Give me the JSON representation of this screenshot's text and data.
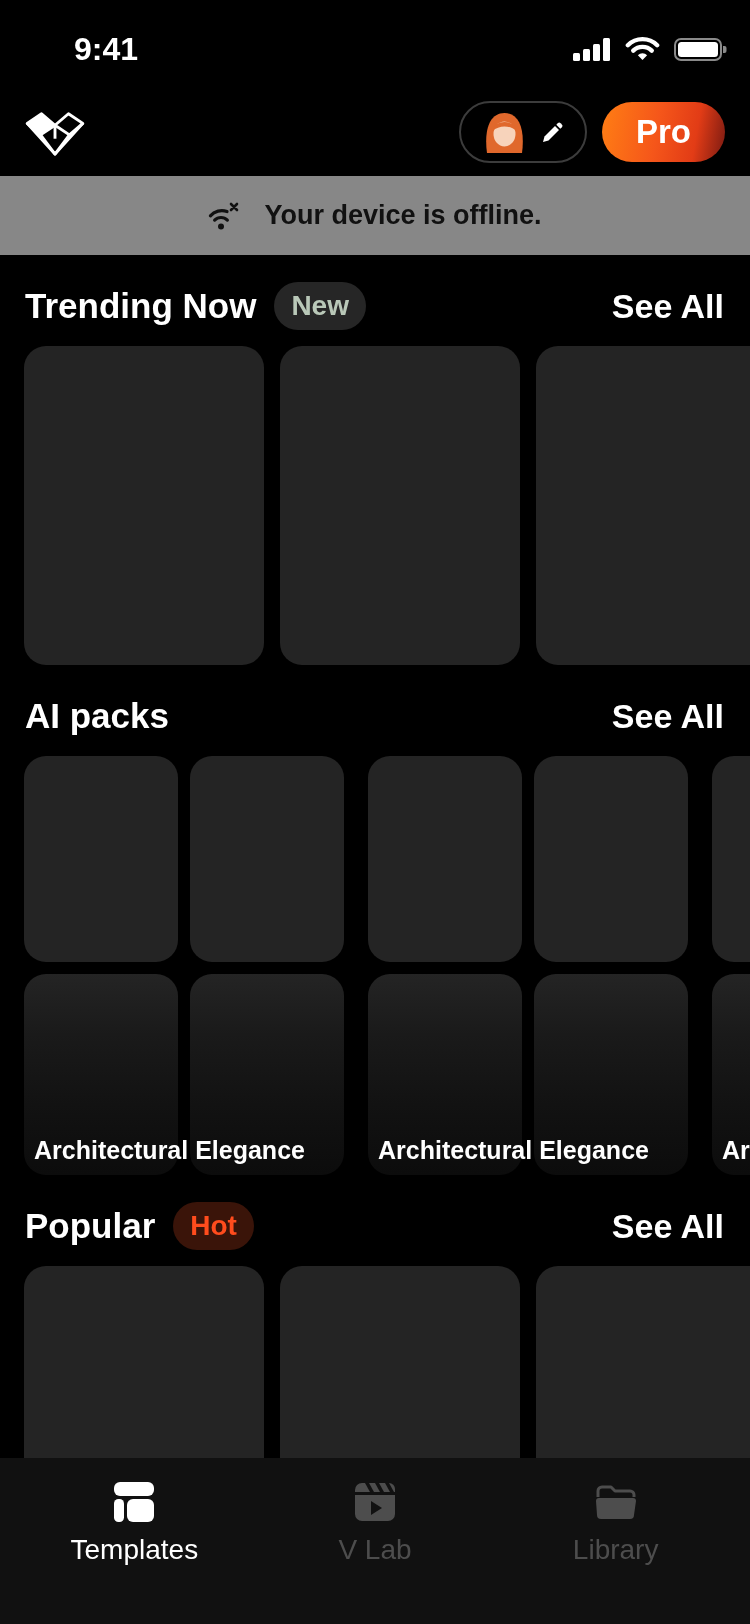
{
  "status_bar": {
    "time": "9:41"
  },
  "header": {
    "pro_button": "Pro"
  },
  "offline_banner": {
    "message": "Your device is offline."
  },
  "sections": [
    {
      "kind": "cards",
      "title": "Trending Now",
      "badge": {
        "label": "New",
        "kind": "new"
      },
      "see_all": "See All",
      "cards": [
        {
          "kind": "thumbnail"
        },
        {
          "kind": "thumbnail"
        },
        {
          "kind": "thumbnail"
        }
      ]
    },
    {
      "kind": "packs",
      "title": "AI packs",
      "see_all": "See All",
      "packs": [
        {
          "title": "Architectural Elegance"
        },
        {
          "title": "Architectural Elegance"
        },
        {
          "title": "Ar"
        }
      ]
    },
    {
      "kind": "cards",
      "title": "Popular",
      "badge": {
        "label": "Hot",
        "kind": "hot"
      },
      "see_all": "See All",
      "cards": [
        {
          "kind": "thumbnail"
        },
        {
          "kind": "thumbnail"
        },
        {
          "kind": "thumbnail"
        }
      ]
    }
  ],
  "tab_bar": [
    {
      "label": "Templates",
      "selected": true
    },
    {
      "label": "V Lab",
      "selected": false
    },
    {
      "label": "Library",
      "selected": false
    }
  ]
}
